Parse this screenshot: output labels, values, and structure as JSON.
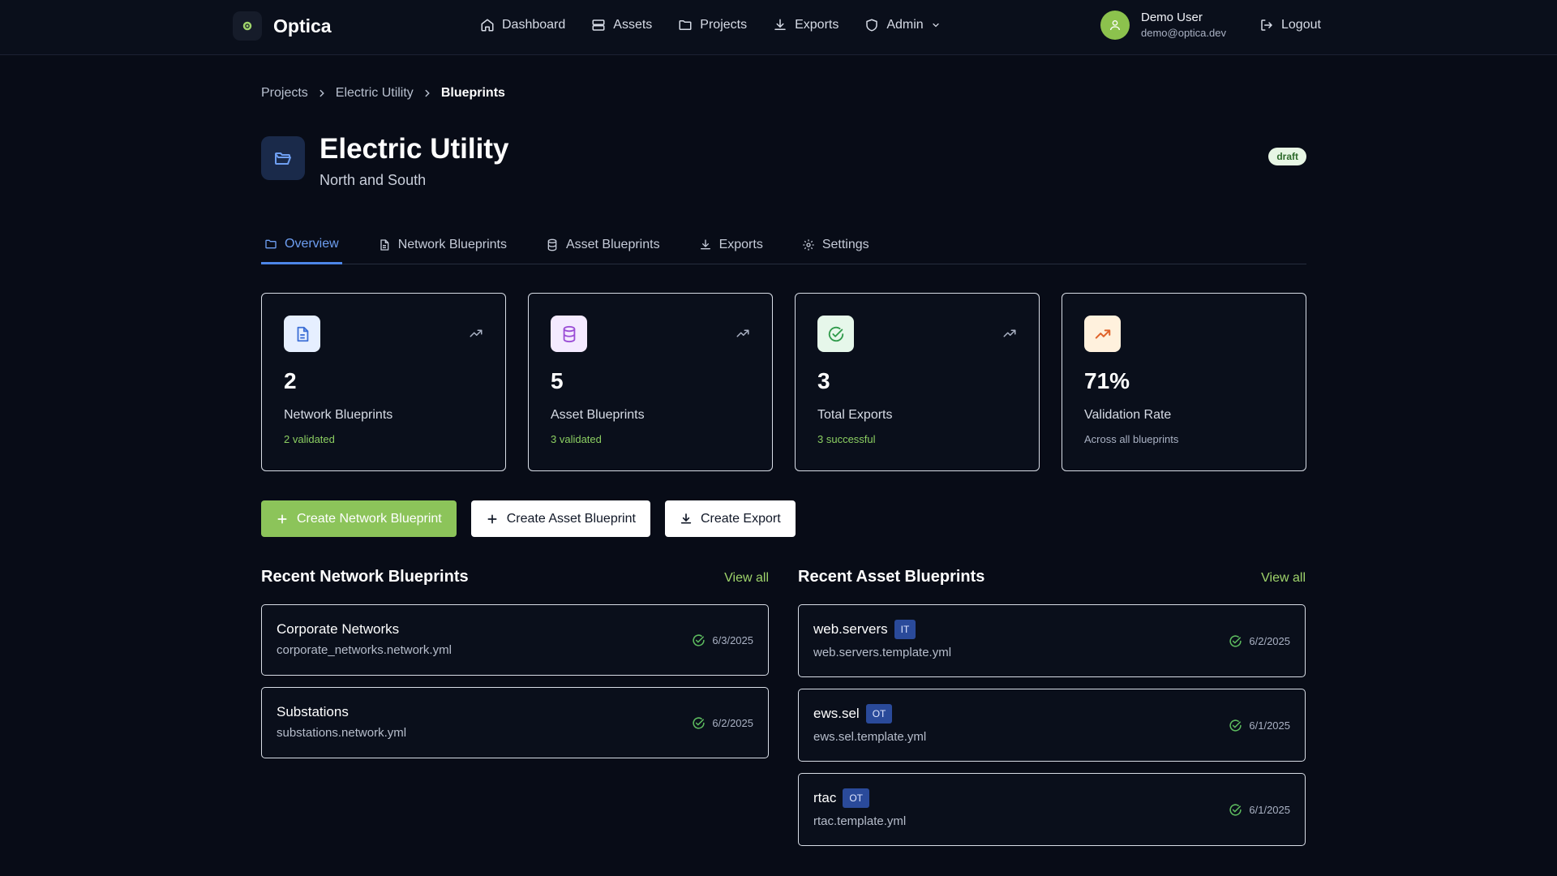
{
  "app": {
    "name": "Optica"
  },
  "nav": {
    "items": [
      {
        "label": "Dashboard",
        "icon": "home-icon"
      },
      {
        "label": "Assets",
        "icon": "server-icon"
      },
      {
        "label": "Projects",
        "icon": "folder-icon"
      },
      {
        "label": "Exports",
        "icon": "download-icon"
      },
      {
        "label": "Admin",
        "icon": "shield-icon"
      }
    ]
  },
  "user": {
    "name": "Demo User",
    "email": "demo@optica.dev",
    "logout_label": "Logout"
  },
  "breadcrumb": [
    "Projects",
    "Electric Utility",
    "Blueprints"
  ],
  "project": {
    "title": "Electric Utility",
    "subtitle": "North and South",
    "status": "draft"
  },
  "tabs": [
    {
      "label": "Overview",
      "active": true
    },
    {
      "label": "Network Blueprints"
    },
    {
      "label": "Asset Blueprints"
    },
    {
      "label": "Exports"
    },
    {
      "label": "Settings"
    }
  ],
  "stats": [
    {
      "value": "2",
      "label": "Network Blueprints",
      "sub": "2 validated",
      "icon": "document-icon",
      "icon_bg": "#e6efff",
      "icon_color": "#3d6fd6"
    },
    {
      "value": "5",
      "label": "Asset Blueprints",
      "sub": "3 validated",
      "icon": "database-icon",
      "icon_bg": "#f4eaff",
      "icon_color": "#9b4ed6"
    },
    {
      "value": "3",
      "label": "Total Exports",
      "sub": "3 successful",
      "icon": "check-circle-icon",
      "icon_bg": "#e6f7ea",
      "icon_color": "#2f9a4a"
    },
    {
      "value": "71%",
      "label": "Validation Rate",
      "sub": "Across all blueprints",
      "icon": "trending-up-icon",
      "icon_bg": "#fff1dd",
      "icon_color": "#e0632a"
    }
  ],
  "actions": {
    "create_network": "Create Network Blueprint",
    "create_asset": "Create Asset Blueprint",
    "create_export": "Create Export"
  },
  "recent_network": {
    "title": "Recent Network Blueprints",
    "view_all": "View all",
    "items": [
      {
        "name": "Corporate Networks",
        "file": "corporate_networks.network.yml",
        "date": "6/3/2025"
      },
      {
        "name": "Substations",
        "file": "substations.network.yml",
        "date": "6/2/2025"
      }
    ]
  },
  "recent_asset": {
    "title": "Recent Asset Blueprints",
    "view_all": "View all",
    "items": [
      {
        "name": "web.servers",
        "tag": "IT",
        "file": "web.servers.template.yml",
        "date": "6/2/2025"
      },
      {
        "name": "ews.sel",
        "tag": "OT",
        "file": "ews.sel.template.yml",
        "date": "6/1/2025"
      },
      {
        "name": "rtac",
        "tag": "OT",
        "file": "rtac.template.yml",
        "date": "6/1/2025"
      }
    ]
  },
  "colors": {
    "accent": "#8cc45a",
    "background": "#080c17",
    "tab_active": "#6e9ff2",
    "validated": "#8ccf62"
  }
}
